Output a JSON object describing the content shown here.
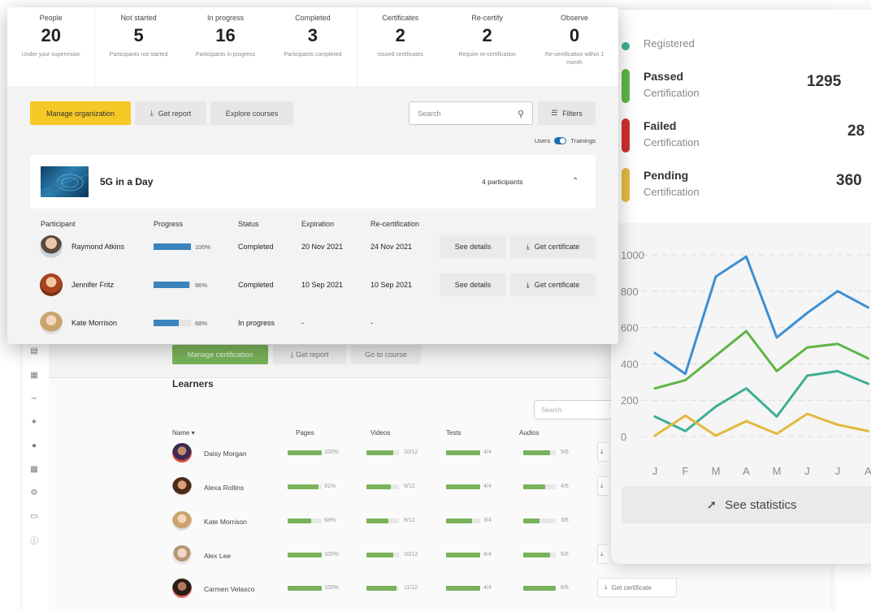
{
  "stats": [
    {
      "label": "People",
      "value": "20",
      "sub": "Under your supervision"
    },
    {
      "label": "Not started",
      "value": "5",
      "sub": "Participants not started"
    },
    {
      "label": "In progress",
      "value": "16",
      "sub": "Participants in progress"
    },
    {
      "label": "Completed",
      "value": "3",
      "sub": "Participants completed"
    },
    {
      "label": "Certificates",
      "value": "2",
      "sub": "Issued certificates"
    },
    {
      "label": "Re-certify",
      "value": "2",
      "sub": "Require re-certification"
    },
    {
      "label": "Observe",
      "value": "0",
      "sub": "Re-certification within 1 month"
    }
  ],
  "toolbar": {
    "manage_label": "Manage organization",
    "report_label": "Get report",
    "explore_label": "Explore courses",
    "search_placeholder": "Search",
    "filters_label": "Filters",
    "toggle_left": "Users",
    "toggle_right": "Trainings"
  },
  "course": {
    "title": "5G in a Day",
    "participants": "4 participants",
    "columns": [
      "Participant",
      "Progress",
      "Status",
      "Expiration",
      "Re-certification"
    ],
    "rows": [
      {
        "name": "Raymond Atkins",
        "progress": 1.0,
        "progress_label": "100%",
        "status": "Completed",
        "expiration": "20 Nov 2021",
        "recert": "24 Nov 2021",
        "details_label": "See details",
        "cert_label": "Get certificate"
      },
      {
        "name": "Jennifer Fritz",
        "progress": 0.96,
        "progress_label": "96%",
        "status": "Completed",
        "expiration": "10 Sep 2021",
        "recert": "10 Sep 2021",
        "details_label": "See details",
        "cert_label": "Get certificate"
      },
      {
        "name": "Kate Morrison",
        "progress": 0.68,
        "progress_label": "68%",
        "status": "In progress",
        "expiration": "-",
        "recert": "-"
      }
    ]
  },
  "back": {
    "manage_cert_label": "Manage certification",
    "report_label": "Get report",
    "course_label": "Go to course",
    "learners_title": "Learners",
    "search_placeholder": "Search",
    "columns": [
      "Name ▾",
      "Pages",
      "Videos",
      "Tests",
      "Audios"
    ],
    "rows": [
      {
        "name": "Daisy Morgan",
        "pages": 1.0,
        "pages_label": "100%",
        "videos": 0.83,
        "videos_label": "10/12",
        "tests": 1.0,
        "tests_label": "4/4",
        "audios": 0.83,
        "audios_label": "5/6"
      },
      {
        "name": "Alexa Rollins",
        "pages": 0.91,
        "pages_label": "91%",
        "videos": 0.75,
        "videos_label": "9/12",
        "tests": 1.0,
        "tests_label": "4/4",
        "audios": 0.67,
        "audios_label": "4/6"
      },
      {
        "name": "Kate Morrison",
        "pages": 0.68,
        "pages_label": "68%",
        "videos": 0.67,
        "videos_label": "8/12",
        "tests": 0.75,
        "tests_label": "3/4",
        "audios": 0.5,
        "audios_label": "3/6"
      },
      {
        "name": "Alex Lee",
        "pages": 1.0,
        "pages_label": "100%",
        "videos": 0.83,
        "videos_label": "10/12",
        "tests": 1.0,
        "tests_label": "4/4",
        "audios": 0.83,
        "audios_label": "5/6"
      },
      {
        "name": "Carmen Velasco",
        "pages": 1.0,
        "pages_label": "100%",
        "videos": 0.92,
        "videos_label": "11/12",
        "tests": 1.0,
        "tests_label": "4/4",
        "audios": 1.0,
        "audios_label": "6/6",
        "cert_label": "Get certificate"
      }
    ]
  },
  "certification": {
    "registered_label": "Registered",
    "items": [
      {
        "name": "Passed",
        "sub": "Certification",
        "value": "1295",
        "color": "#5fb547"
      },
      {
        "name": "Failed",
        "sub": "Certification",
        "value": "28",
        "color": "#cf2f2f"
      },
      {
        "name": "Pending",
        "sub": "Certification",
        "value": "360",
        "color": "#e3b93e"
      }
    ],
    "registered_color": "#3fae94",
    "see_stats_label": "See statistics"
  },
  "chart_data": {
    "type": "line",
    "categories": [
      "J",
      "F",
      "M",
      "A",
      "M",
      "J",
      "J",
      "A"
    ],
    "ylim": [
      0,
      1000
    ],
    "yticks": [
      "0",
      "200",
      "400",
      "600",
      "800",
      "1000"
    ],
    "grid": true,
    "series": [
      {
        "color": "#3d8fd3",
        "values": [
          460,
          345,
          880,
          990,
          545,
          680,
          800,
          710
        ]
      },
      {
        "color": "#5fb547",
        "values": [
          265,
          310,
          445,
          580,
          360,
          490,
          510,
          430
        ]
      },
      {
        "color": "#3fae94",
        "values": [
          110,
          30,
          165,
          265,
          110,
          335,
          360,
          290
        ]
      },
      {
        "color": "#e3b93e",
        "values": [
          5,
          115,
          5,
          85,
          15,
          125,
          65,
          30
        ]
      }
    ]
  }
}
